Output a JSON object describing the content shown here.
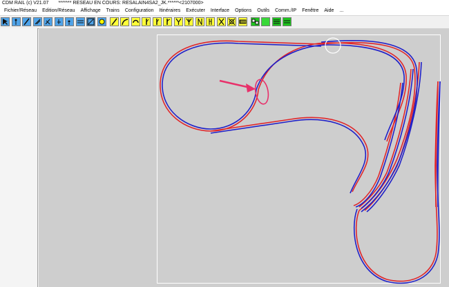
{
  "window": {
    "app_title": "CDM RAIL  (c) V21.07",
    "document_title": "******* RESEAU EN COURS: RESALAIN4SA2_JK.******<2107000>"
  },
  "menu": {
    "items": [
      "Fichier/Réseau",
      "Edition/Réseau",
      "Affichage",
      "Trains",
      "Configuration",
      "Itinéraires",
      "Exécuter",
      "Interface",
      "Options",
      "Outils",
      "Comm./IP",
      "Fenêtre",
      "Aide",
      "..."
    ]
  },
  "toolbar": {
    "buttons": [
      {
        "name": "select-arrow-icon",
        "style": "blue"
      },
      {
        "name": "signal-icon",
        "style": "blue"
      },
      {
        "name": "diagonal-track-icon",
        "style": "blue"
      },
      {
        "name": "track-tools-icon",
        "style": "blue"
      },
      {
        "name": "curve-tool-icon",
        "style": "blue"
      },
      {
        "name": "buffer-stop-icon",
        "style": "blue"
      },
      {
        "name": "sensor-icon",
        "style": "blue"
      },
      {
        "name": "parallel-track-icon",
        "style": "blue"
      },
      {
        "name": "measure-icon",
        "style": "blue"
      },
      {
        "name": "clock-icon",
        "style": "blue"
      },
      {
        "name": "straight-track-icon",
        "style": "yellow"
      },
      {
        "name": "curve-track-icon",
        "style": "yellow"
      },
      {
        "name": "loop-track-icon",
        "style": "yellow"
      },
      {
        "name": "switch-left-icon",
        "style": "yellow"
      },
      {
        "name": "switch-right-icon",
        "style": "yellow"
      },
      {
        "name": "switch-curved-icon",
        "style": "yellow"
      },
      {
        "name": "switch-y-icon",
        "style": "yellow"
      },
      {
        "name": "three-way-switch-icon",
        "style": "yellow"
      },
      {
        "name": "double-slip-icon",
        "style": "yellow"
      },
      {
        "name": "crossing-icon",
        "style": "yellow"
      },
      {
        "name": "crossing-x-icon",
        "style": "yellow"
      },
      {
        "name": "turntable-icon",
        "style": "yellow"
      },
      {
        "name": "bridge-icon",
        "style": "yellow"
      },
      {
        "name": "tunnel-icon",
        "style": "green"
      },
      {
        "name": "block-icon",
        "style": "lgreen"
      },
      {
        "name": "list-icon",
        "style": "green"
      },
      {
        "name": "grid-icon",
        "style": "green"
      }
    ]
  },
  "colors": {
    "track_red": "#e0262a",
    "track_blue": "#2020c8",
    "canvas_bg": "#cecece",
    "annotation_pink": "#e8306a",
    "yellow_button": "#ffff38",
    "blue_button": "#4fa3e8",
    "green_button": "#1ec51e"
  }
}
